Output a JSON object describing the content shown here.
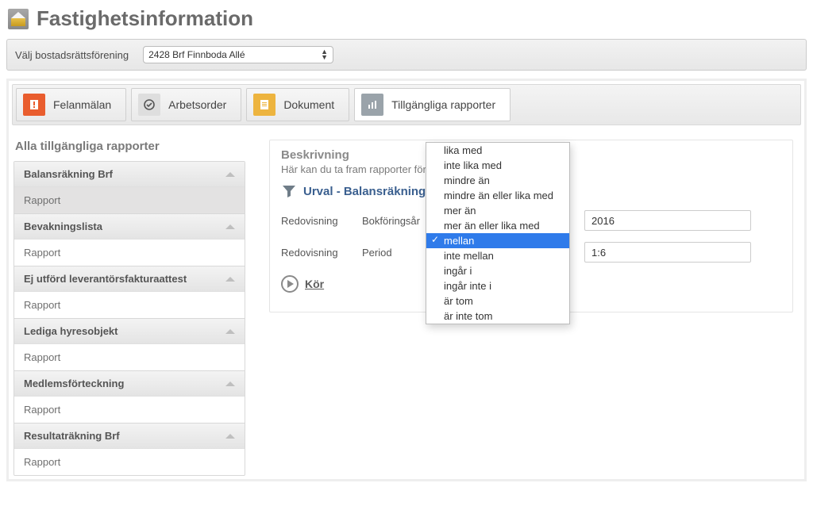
{
  "header": {
    "title": "Fastighetsinformation"
  },
  "selector": {
    "label": "Välj bostadsrättsförening",
    "value": "2428 Brf Finnboda Allé"
  },
  "tabs": [
    {
      "id": "felanmalan",
      "label": "Felanmälan",
      "icon": "alert-icon"
    },
    {
      "id": "arbetsorder",
      "label": "Arbetsorder",
      "icon": "clock-check-icon"
    },
    {
      "id": "dokument",
      "label": "Dokument",
      "icon": "document-lines-icon"
    },
    {
      "id": "rapporter",
      "label": "Tillgängliga rapporter",
      "icon": "bar-chart-icon",
      "active": true
    }
  ],
  "sidebar": {
    "title": "Alla tillgängliga rapporter",
    "item_label": "Rapport",
    "groups": [
      {
        "title": "Balansräkning Brf",
        "selected": true
      },
      {
        "title": "Bevakningslista"
      },
      {
        "title": "Ej utförd leverantörsfakturaattest"
      },
      {
        "title": "Lediga hyresobjekt"
      },
      {
        "title": "Medlemsförteckning"
      },
      {
        "title": "Resultaträkning Brf"
      }
    ]
  },
  "detail": {
    "desc_label": "Beskrivning",
    "desc_text": "Här kan du ta fram rapporter för",
    "filter_title": "Urval - Balansräkning B",
    "rows": [
      {
        "cat": "Redovisning",
        "field": "Bokföringsår",
        "value": "2016"
      },
      {
        "cat": "Redovisning",
        "field": "Period",
        "value": "1:6"
      }
    ],
    "run_label": "Kör"
  },
  "dropdown": {
    "options": [
      "lika med",
      "inte lika med",
      "mindre än",
      "mindre än eller lika med",
      "mer än",
      "mer än eller lika med",
      "mellan",
      "inte mellan",
      "ingår i",
      "ingår inte i",
      "är tom",
      "är inte tom"
    ],
    "selected": "mellan"
  }
}
